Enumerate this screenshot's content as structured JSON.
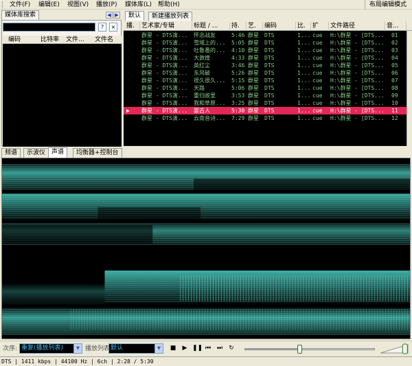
{
  "menubar": {
    "items": [
      "文件(F)",
      "编辑(E)",
      "视图(V)",
      "播放(P)",
      "媒体库(L)",
      "帮助(H)"
    ],
    "layout_mode": "布局编辑模式"
  },
  "library": {
    "tab": "媒体库搜索",
    "search_value": "",
    "search_help": "?",
    "search_clear": "×",
    "columns": [
      "编码",
      "比特率",
      "文件...",
      "文件名"
    ]
  },
  "playlist": {
    "tabs": [
      "默认",
      "新建播放列表"
    ],
    "columns": [
      "播.",
      "艺术家/专辑",
      "标题 / ...",
      "持.",
      "艺.",
      "编码",
      "比.",
      "扩",
      "文件路径",
      "音..."
    ],
    "rows": [
      {
        "artist": "群星 - DTS演...",
        "title": "怀念战友",
        "dur": "5:46",
        "ar": "群星",
        "codec": "DTS",
        "br": "1...",
        "ext": "cue",
        "path": "H:\\群星 - [DTS...",
        "track": "01"
      },
      {
        "artist": "群星 - DTS演...",
        "title": "雪域上的...",
        "dur": "5:05",
        "ar": "群星",
        "codec": "DTS",
        "br": "1...",
        "ext": "cue",
        "path": "H:\\群星 - [DTS...",
        "track": "02"
      },
      {
        "artist": "群星 - DTS演...",
        "title": "吐鲁番的...",
        "dur": "4:10",
        "ar": "群星",
        "codec": "DTS",
        "br": "1...",
        "ext": "cue",
        "path": "H:\\群星 - [DTS...",
        "track": "03"
      },
      {
        "artist": "群星 - DTS演...",
        "title": "大敦煌",
        "dur": "4:33",
        "ar": "群星",
        "codec": "DTS",
        "br": "1...",
        "ext": "cue",
        "path": "H:\\群星 - [DTS...",
        "track": "04"
      },
      {
        "artist": "群星 - DTS演...",
        "title": "英红尘",
        "dur": "3:46",
        "ar": "群星",
        "codec": "DTS",
        "br": "1...",
        "ext": "cue",
        "path": "H:\\群星 - [DTS...",
        "track": "05"
      },
      {
        "artist": "群星 - DTS演...",
        "title": "东风破",
        "dur": "5:26",
        "ar": "群星",
        "codec": "DTS",
        "br": "1...",
        "ext": "cue",
        "path": "H:\\群星 - [DTS...",
        "track": "06"
      },
      {
        "artist": "群星 - DTS演...",
        "title": "很久很久...",
        "dur": "5:15",
        "ar": "群星",
        "codec": "DTS",
        "br": "1...",
        "ext": "cue",
        "path": "H:\\群星 - [DTS...",
        "track": "07"
      },
      {
        "artist": "群星 - DTS演...",
        "title": "天路",
        "dur": "5:06",
        "ar": "群星",
        "codec": "DTS",
        "br": "1...",
        "ext": "cue",
        "path": "H:\\群星 - [DTS...",
        "track": "08"
      },
      {
        "artist": "群星 - DTS演...",
        "title": "重归故里",
        "dur": "3:53",
        "ar": "群星",
        "codec": "DTS",
        "br": "1...",
        "ext": "cue",
        "path": "H:\\群星 - [DTS...",
        "track": "09"
      },
      {
        "artist": "群星 - DTS演...",
        "title": "我和草原...",
        "dur": "3:25",
        "ar": "群星",
        "codec": "DTS",
        "br": "1...",
        "ext": "cue",
        "path": "H:\\群星 - [DTS...",
        "track": "10"
      },
      {
        "artist": "群星 - DTS演...",
        "title": "婴古人",
        "dur": "5:30",
        "ar": "群星",
        "codec": "DTS",
        "br": "1...",
        "ext": "cue",
        "path": "H:\\群星 - [DTS...",
        "track": "11",
        "playing": true
      },
      {
        "artist": "群星 - DTS演...",
        "title": "云南音诗...",
        "dur": "7:29",
        "ar": "群星",
        "codec": "DTS",
        "br": "1...",
        "ext": "cue",
        "path": "H:\\群星 - [DTS...",
        "track": "12"
      }
    ]
  },
  "visualization": {
    "tabs": [
      "频谱",
      "示波仪",
      "声谱",
      "均衡器+控制台"
    ],
    "active_tab": "声谱"
  },
  "controls": {
    "order_label": "次序:",
    "order_value": "重复(播放列表)",
    "playlist_label": "播放列表:",
    "playlist_value": "默认",
    "buttons": [
      "■",
      "▶",
      "❚❚",
      "⏮",
      "⏭",
      "↻"
    ],
    "seek_fraction": 0.416,
    "volume_fraction": 0.95
  },
  "status": "DTS | 1411 kbps | 44100 Hz | 6ch | 2:28 / 5:30",
  "colors": {
    "playlist_text": "#88cc88",
    "playing_row": "#e32756",
    "spectrogram": "#3fb5a8",
    "combo_text": "#3fb6e8"
  }
}
